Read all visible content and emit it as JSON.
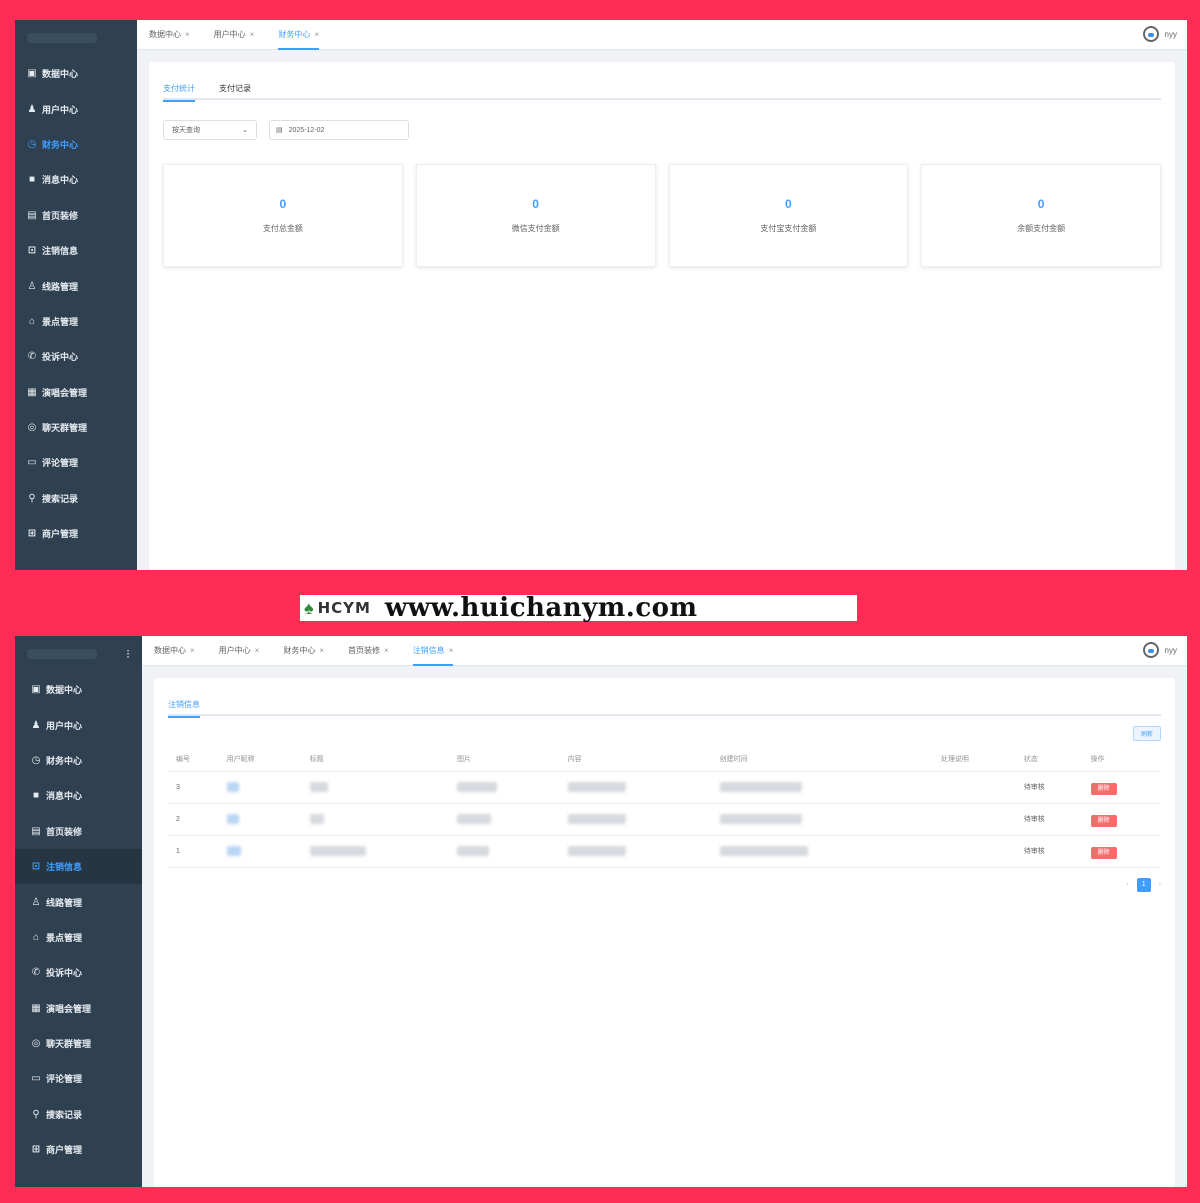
{
  "shot1": {
    "menu": [
      {
        "label": "数据中心",
        "icon": "calendar-icon",
        "glyph": "▣"
      },
      {
        "label": "用户中心",
        "icon": "user-icon",
        "glyph": "♟"
      },
      {
        "label": "财务中心",
        "icon": "clock-icon",
        "glyph": "◷",
        "active": true
      },
      {
        "label": "消息中心",
        "icon": "message-icon",
        "glyph": "■"
      },
      {
        "label": "首页装修",
        "icon": "document-icon",
        "glyph": "▤"
      },
      {
        "label": "注销信息",
        "icon": "logout-icon",
        "glyph": "⊡"
      },
      {
        "label": "线路管理",
        "icon": "person-icon",
        "glyph": "♙"
      },
      {
        "label": "景点管理",
        "icon": "home-icon",
        "glyph": "⌂"
      },
      {
        "label": "投诉中心",
        "icon": "phone-icon",
        "glyph": "✆"
      },
      {
        "label": "演唱会管理",
        "icon": "grid-icon",
        "glyph": "▦"
      },
      {
        "label": "聊天群管理",
        "icon": "chat-icon",
        "glyph": "◎"
      },
      {
        "label": "评论管理",
        "icon": "comment-icon",
        "glyph": "▭"
      },
      {
        "label": "搜索记录",
        "icon": "search-icon",
        "glyph": "⚲"
      },
      {
        "label": "商户管理",
        "icon": "shop-icon",
        "glyph": "⊞"
      }
    ],
    "tabs": [
      {
        "label": "数据中心"
      },
      {
        "label": "用户中心"
      },
      {
        "label": "财务中心",
        "active": true
      }
    ],
    "close_glyph": "×",
    "user": "nyy",
    "sub_tabs": [
      {
        "label": "支付统计",
        "active": true
      },
      {
        "label": "支付记录"
      }
    ],
    "filter_select": "按天查询",
    "filter_select_arrow": "⌄",
    "calendar_glyph": "▤",
    "filter_date": "2025-12-02",
    "stats": [
      {
        "value": "0",
        "label": "支付总金额"
      },
      {
        "value": "0",
        "label": "微信支付金额"
      },
      {
        "value": "0",
        "label": "支付宝支付金额"
      },
      {
        "value": "0",
        "label": "余额支付金额"
      }
    ]
  },
  "shot2": {
    "collapse_glyph": "⁝",
    "tabs": [
      {
        "label": "数据中心"
      },
      {
        "label": "用户中心"
      },
      {
        "label": "财务中心"
      },
      {
        "label": "首页装修"
      },
      {
        "label": "注销信息",
        "active": true
      }
    ],
    "user": "nyy",
    "sub_tab": "注销信息",
    "toolbar_button": "刷新",
    "columns": [
      "编号",
      "用户昵称",
      "标题",
      "图片",
      "内容",
      "创建时间",
      "处理说明",
      "状态",
      "操作"
    ],
    "rows": [
      {
        "id": "3",
        "status": "待审核",
        "action": "删除"
      },
      {
        "id": "2",
        "status": "待审核",
        "action": "删除"
      },
      {
        "id": "1",
        "status": "待审核",
        "action": "删除"
      }
    ],
    "pager": {
      "prev": "‹",
      "page": "1",
      "next": "›"
    }
  },
  "watermark": {
    "brand": "HCYM",
    "url": "www.huichanym.com",
    "icon": "shovel-icon",
    "glyph": "♠"
  }
}
